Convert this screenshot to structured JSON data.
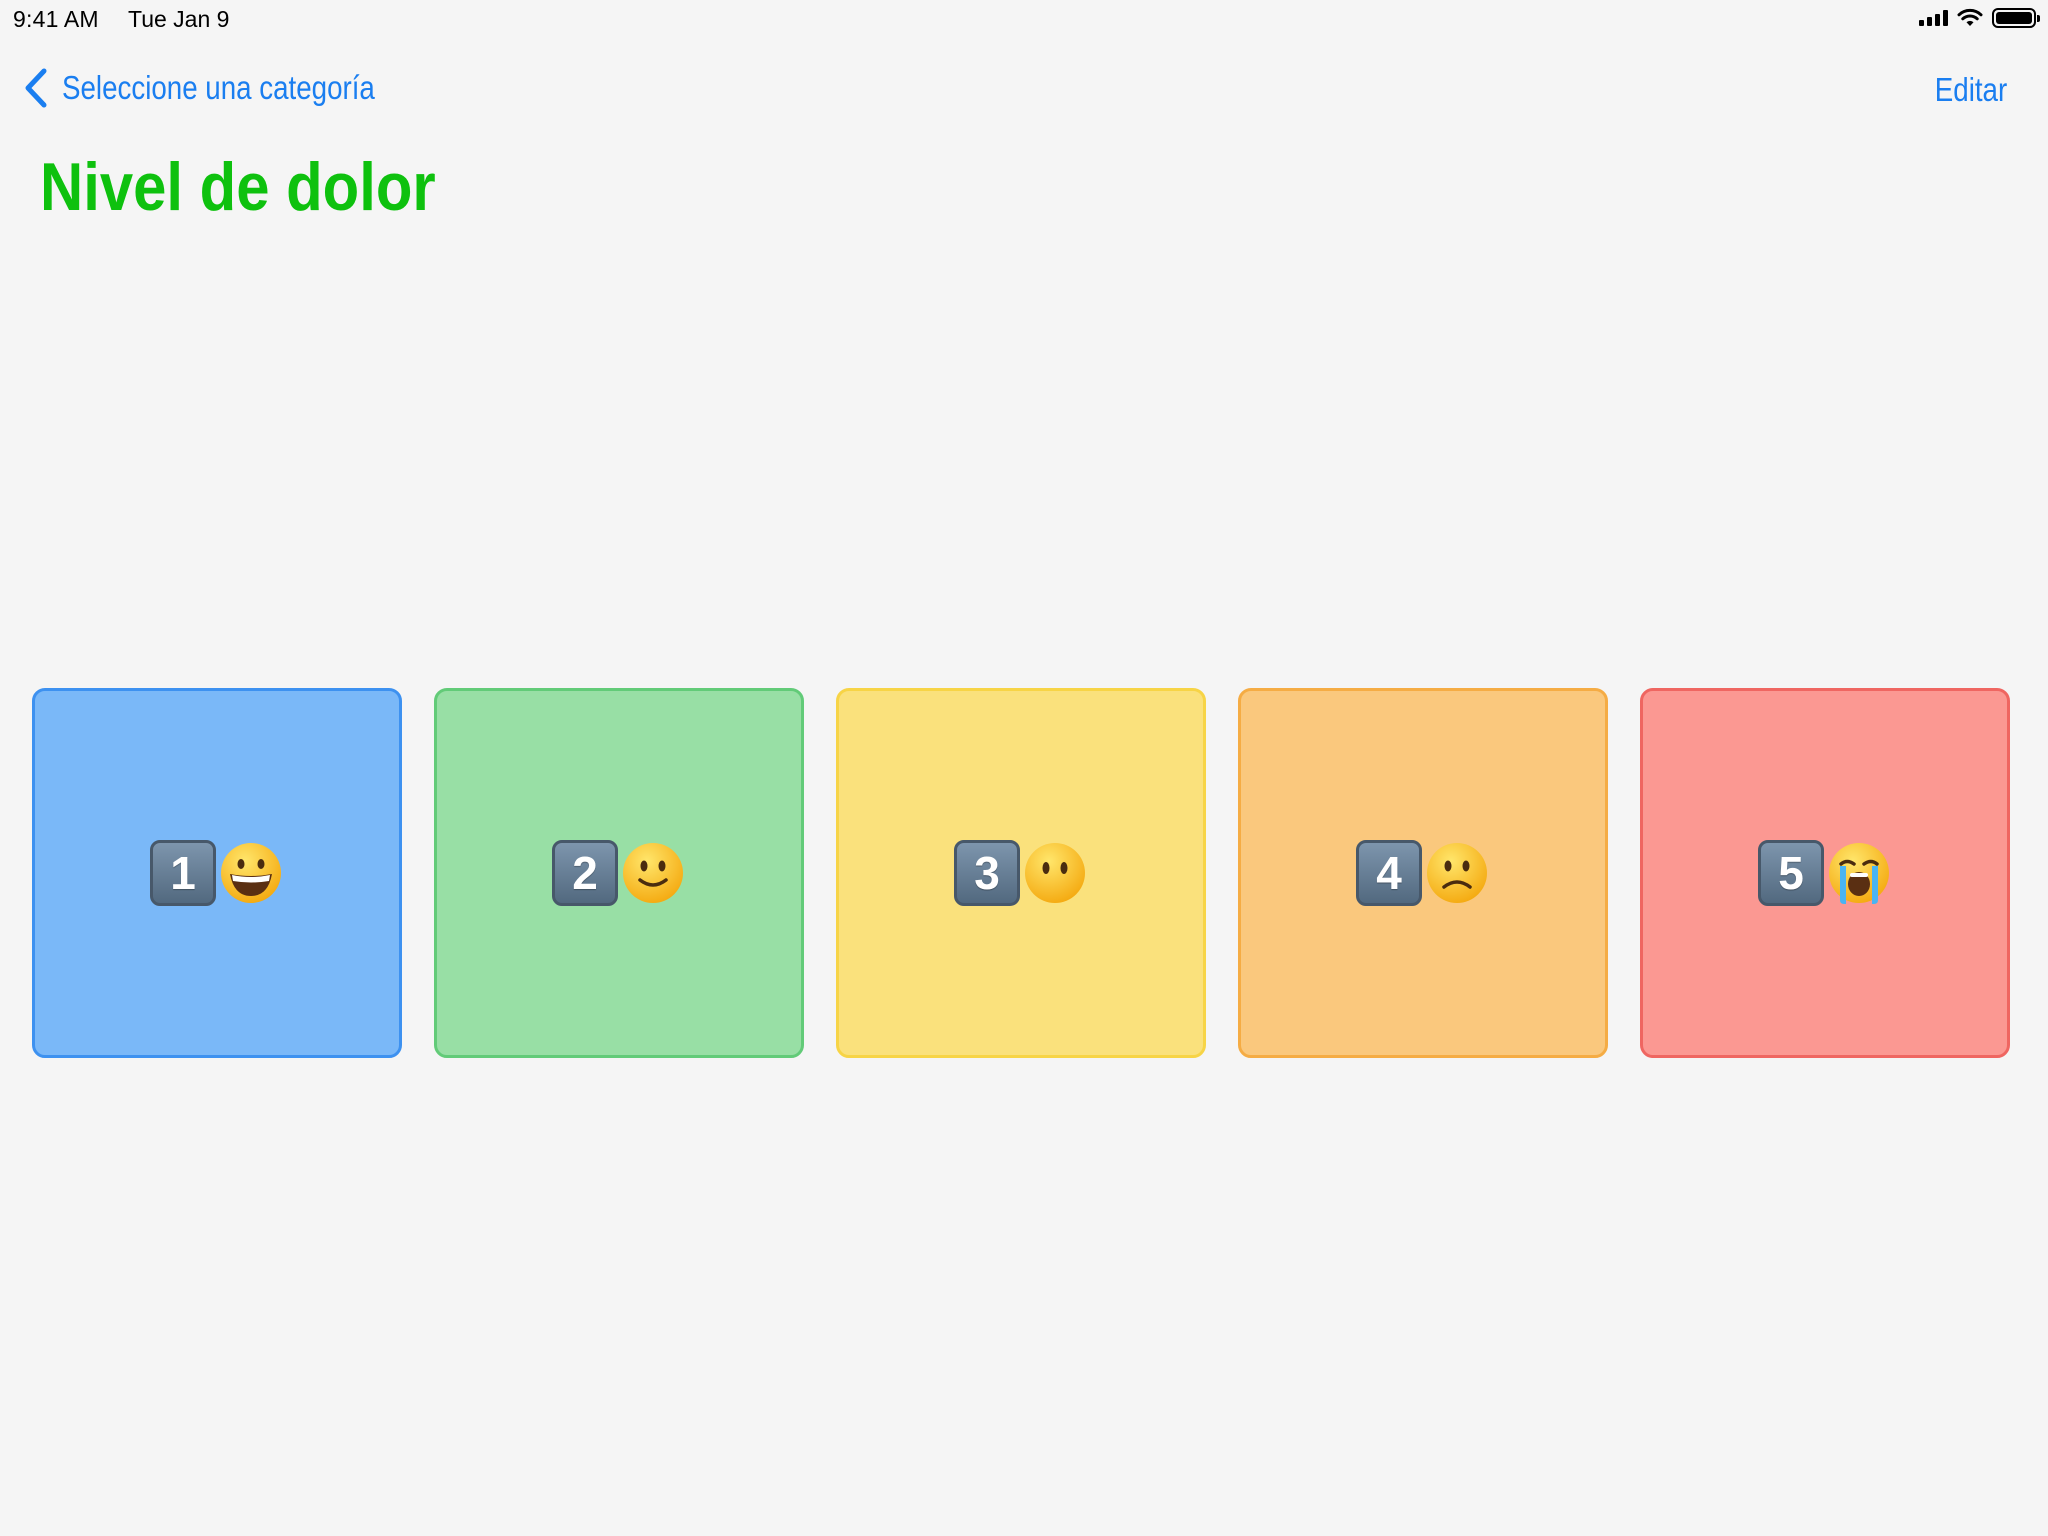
{
  "status_bar": {
    "time": "9:41 AM",
    "date": "Tue Jan 9"
  },
  "navbar": {
    "back_label": "Seleccione una categoría",
    "edit_label": "Editar"
  },
  "title": "Nivel de dolor",
  "colors": {
    "accent": "#1a7ef0",
    "title": "#0ec10e",
    "background": "#f5f5f5"
  },
  "tiles": [
    {
      "number": "1",
      "face": "grinning-face-icon",
      "bg": "#7ab8f8",
      "border": "#3d91f0"
    },
    {
      "number": "2",
      "face": "slightly-smiling-face-icon",
      "bg": "#98dfa5",
      "border": "#62cb78"
    },
    {
      "number": "3",
      "face": "face-without-mouth-icon",
      "bg": "#fae17c",
      "border": "#f7d446"
    },
    {
      "number": "4",
      "face": "slightly-frowning-face-icon",
      "bg": "#fac87d",
      "border": "#f5ac44"
    },
    {
      "number": "5",
      "face": "loudly-crying-face-icon",
      "bg": "#fb9892",
      "border": "#ef6661"
    }
  ]
}
